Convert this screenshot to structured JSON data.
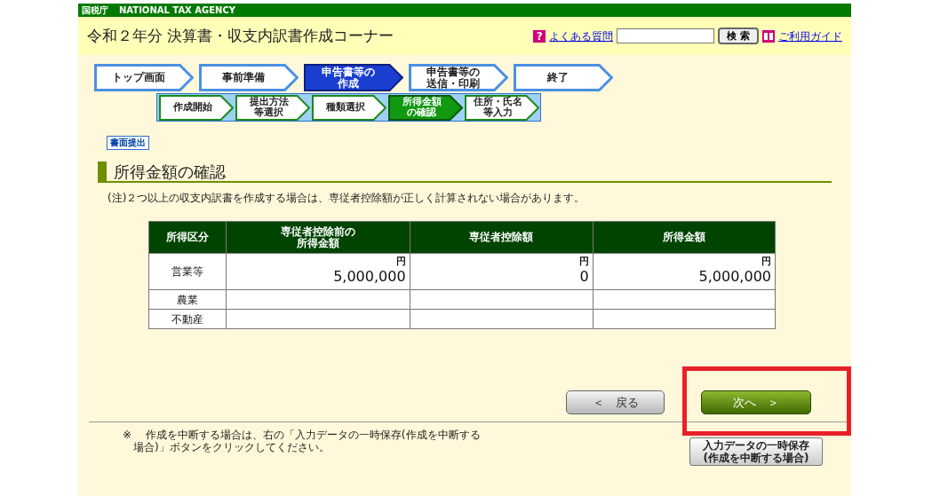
{
  "agency_bar": {
    "kanji": "国税庁",
    "name": "NATIONAL TAX AGENCY"
  },
  "header": {
    "title": "令和２年分 決算書・収支内訳書作成コーナー",
    "help_mark": "?",
    "faq_link": "よくある質問",
    "search": {
      "button": "検 索"
    },
    "guide_link": "ご利用ガイド"
  },
  "steps": [
    {
      "lines": [
        "トップ画面"
      ],
      "selected": false
    },
    {
      "lines": [
        "事前準備"
      ],
      "selected": false
    },
    {
      "lines": [
        "申告書等の",
        "作成"
      ],
      "selected": true
    },
    {
      "lines": [
        "申告書等の",
        "送信・印刷"
      ],
      "selected": false
    },
    {
      "lines": [
        "終了"
      ],
      "selected": false
    }
  ],
  "sub_steps": [
    {
      "lines": [
        "作成開始"
      ],
      "selected": false
    },
    {
      "lines": [
        "提出方法",
        "等選択"
      ],
      "selected": false
    },
    {
      "lines": [
        "種類選択"
      ],
      "selected": false
    },
    {
      "lines": [
        "所得金額",
        "の確認"
      ],
      "selected": true
    },
    {
      "lines": [
        "住所・氏名",
        "等入力"
      ],
      "selected": false
    }
  ],
  "mode_badge": "書面提出",
  "section_title": "所得金額の確認",
  "note": "(注)２つ以上の収支内訳書を作成する場合は、専従者控除額が正しく計算されない場合があります。",
  "table": {
    "columns": [
      "所得区分",
      "専従者控除前の所得金額",
      "専従者控除額",
      "所得金額"
    ],
    "rows": [
      [
        "営業等",
        {
          "unit": "円",
          "amount": "5,000,000"
        },
        {
          "unit": "円",
          "amount": "0"
        },
        {
          "unit": "円",
          "amount": "5,000,000"
        }
      ],
      [
        "農業"
      ],
      [
        "不動産"
      ]
    ]
  },
  "back_button": "＜　戻る",
  "next_button": "次へ　＞",
  "highlight_next": true,
  "footer_note": [
    "※　 作成を中断する場合は、右の「入力データの一時保存(作成を中断する",
    "　場合)」ボタンをクリックしてください。"
  ],
  "save_button": [
    "入力データの一時保存",
    "(作成を中断する場合)"
  ]
}
